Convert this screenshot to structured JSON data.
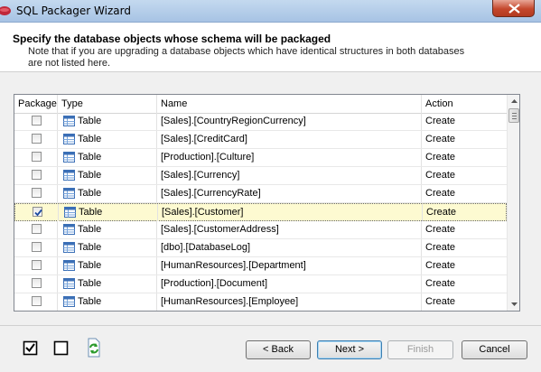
{
  "window": {
    "title": "SQL Packager Wizard"
  },
  "header": {
    "title": "Specify the database objects whose schema will be packaged",
    "note": "Note that if you are upgrading a database objects which have identical structures in both databases are not listed here."
  },
  "table": {
    "columns": [
      "Package",
      "Type",
      "Name",
      "Action"
    ],
    "rows": [
      {
        "checked": false,
        "type": "Table",
        "name": "[Sales].[CountryRegionCurrency]",
        "action": "Create"
      },
      {
        "checked": false,
        "type": "Table",
        "name": "[Sales].[CreditCard]",
        "action": "Create"
      },
      {
        "checked": false,
        "type": "Table",
        "name": "[Production].[Culture]",
        "action": "Create"
      },
      {
        "checked": false,
        "type": "Table",
        "name": "[Sales].[Currency]",
        "action": "Create"
      },
      {
        "checked": false,
        "type": "Table",
        "name": "[Sales].[CurrencyRate]",
        "action": "Create"
      },
      {
        "checked": true,
        "type": "Table",
        "name": "[Sales].[Customer]",
        "action": "Create",
        "selected": true
      },
      {
        "checked": false,
        "type": "Table",
        "name": "[Sales].[CustomerAddress]",
        "action": "Create"
      },
      {
        "checked": false,
        "type": "Table",
        "name": "[dbo].[DatabaseLog]",
        "action": "Create"
      },
      {
        "checked": false,
        "type": "Table",
        "name": "[HumanResources].[Department]",
        "action": "Create"
      },
      {
        "checked": false,
        "type": "Table",
        "name": "[Production].[Document]",
        "action": "Create"
      },
      {
        "checked": false,
        "type": "Table",
        "name": "[HumanResources].[Employee]",
        "action": "Create"
      }
    ]
  },
  "footer": {
    "tools": [
      {
        "icon": "check-all-icon"
      },
      {
        "icon": "uncheck-all-icon"
      },
      {
        "icon": "refresh-icon"
      }
    ],
    "buttons": {
      "back": "< Back",
      "next": "Next >",
      "finish": "Finish",
      "cancel": "Cancel"
    }
  },
  "colors": {
    "selected_row": "#fdfad1",
    "title_bar": "#b9d1ea",
    "close_button": "#c4472c"
  }
}
